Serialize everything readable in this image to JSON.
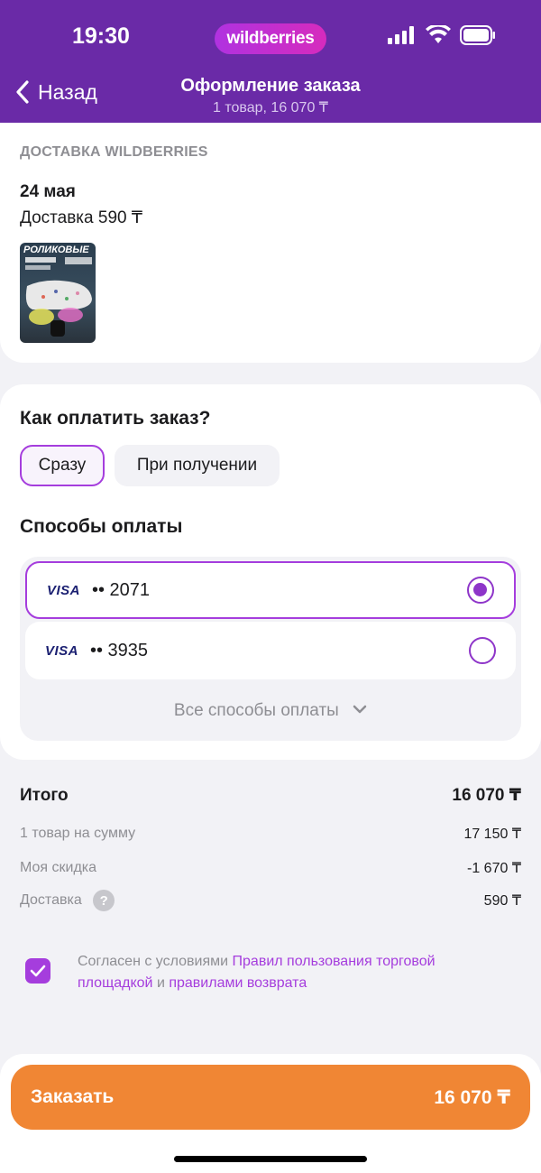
{
  "status_bar": {
    "time": "19:30",
    "brand": "wildberries"
  },
  "nav": {
    "back_label": "Назад",
    "title": "Оформление заказа",
    "subtitle": "1 товар, 16 070 ₸"
  },
  "delivery": {
    "caption": "ДОСТАВКА WILDBERRIES",
    "date": "24 мая",
    "cost_label": "Доставка 590 ₸",
    "product_thumb_text": "РОЛИКОВЫЕ"
  },
  "payment": {
    "question": "Как оплатить заказ?",
    "options": [
      {
        "label": "Сразу",
        "selected": true
      },
      {
        "label": "При получении",
        "selected": false
      }
    ],
    "methods_title": "Способы оплаты",
    "methods": [
      {
        "brand": "VISA",
        "number": "•• 2071",
        "selected": true
      },
      {
        "brand": "VISA",
        "number": "•• 3935",
        "selected": false
      }
    ],
    "all_methods_label": "Все способы оплаты"
  },
  "totals": {
    "total_label": "Итого",
    "total_value": "16 070 ₸",
    "items_label": "1 товар на сумму",
    "items_value": "17 150 ₸",
    "discount_label": "Моя скидка",
    "discount_value": "-1 670 ₸",
    "delivery_label": "Доставка",
    "delivery_value": "590 ₸",
    "help_glyph": "?"
  },
  "agreement": {
    "prefix": "Согласен с условиями ",
    "link1": "Правил пользования торговой площадкой",
    "middle": " и ",
    "link2": "правилами возврата",
    "checked": true
  },
  "order_button": {
    "label": "Заказать",
    "amount": "16 070 ₸"
  },
  "colors": {
    "header": "#6a2aa7",
    "accent": "#a53ddd",
    "order": "#f08634"
  }
}
